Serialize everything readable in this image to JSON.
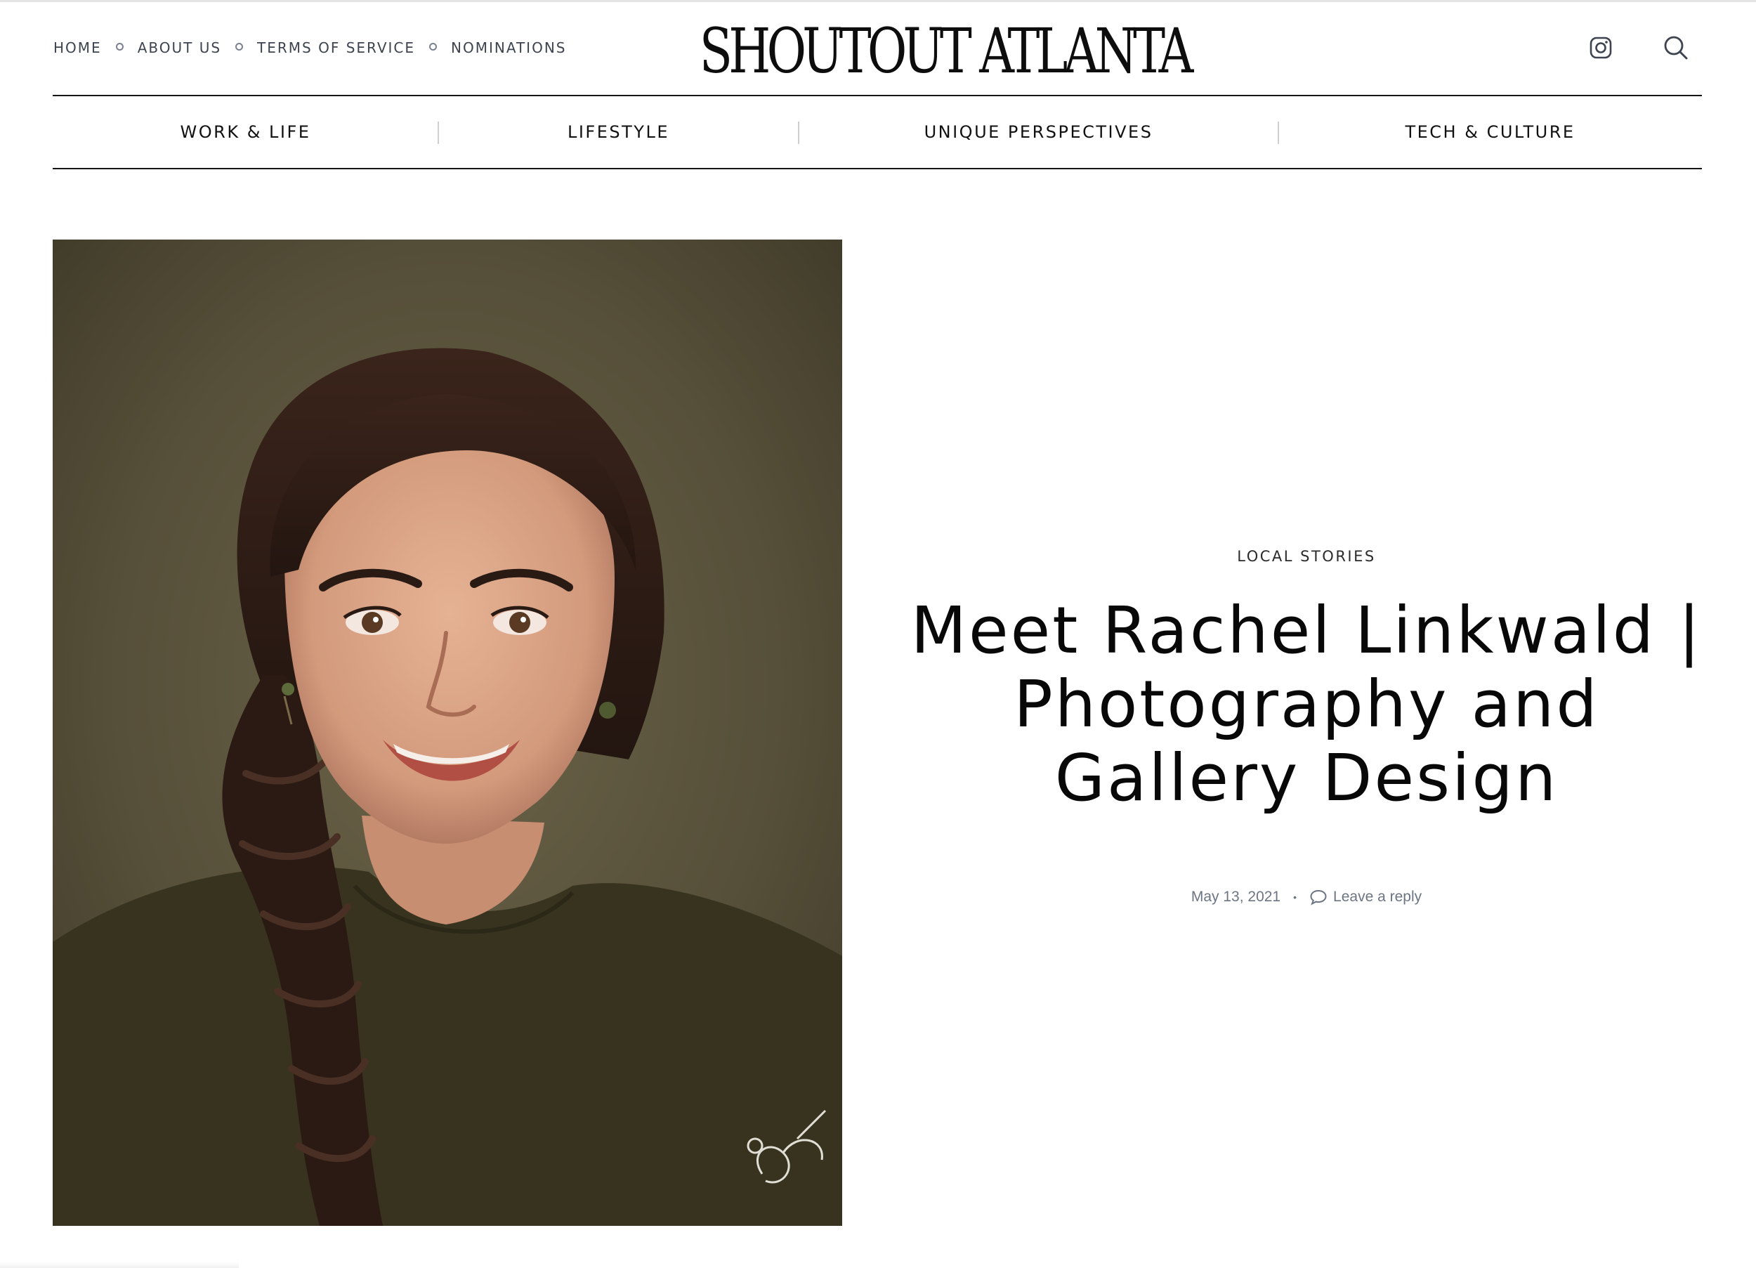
{
  "site": {
    "logo": "SHOUTOUT ATLANTA"
  },
  "utility_nav": {
    "items": [
      {
        "label": "HOME"
      },
      {
        "label": "ABOUT US"
      },
      {
        "label": "TERMS OF SERVICE"
      },
      {
        "label": "NOMINATIONS"
      }
    ]
  },
  "header_icons": {
    "instagram": "instagram-icon",
    "search": "search-icon"
  },
  "category_nav": {
    "items": [
      {
        "label": "WORK & LIFE"
      },
      {
        "label": "LIFESTYLE"
      },
      {
        "label": "UNIQUE PERSPECTIVES"
      },
      {
        "label": "TECH & CULTURE"
      }
    ]
  },
  "post": {
    "category": "LOCAL STORIES",
    "title": "Meet Rachel Linkwald | Photography and Gallery Design",
    "date": "May 13, 2021",
    "meta_separator": "•",
    "reply_label": "Leave a reply",
    "image": {
      "watermark": "Shayna Image"
    }
  },
  "colors": {
    "text": "#111111",
    "muted": "#6c7583",
    "rule": "#151515",
    "photo_background": "#5a533c"
  }
}
